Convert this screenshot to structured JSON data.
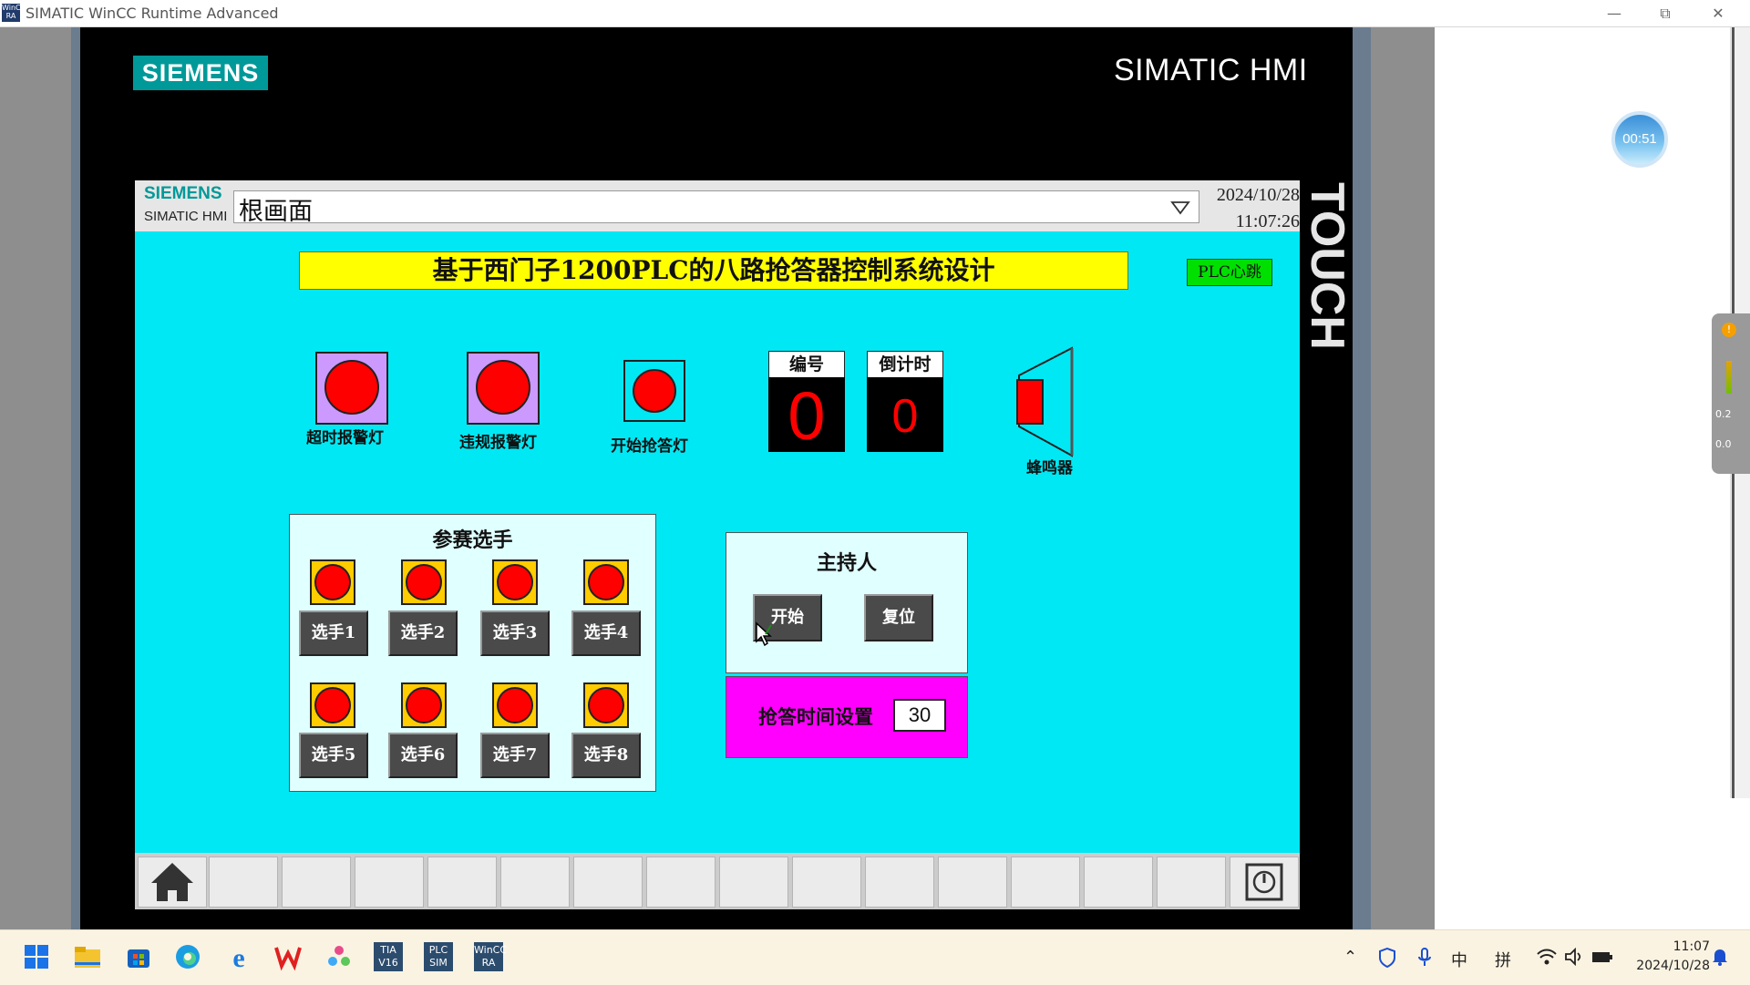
{
  "window": {
    "title": "SIMATIC WinCC Runtime Advanced",
    "app_icon": "WinCC RA",
    "controls": [
      "minimize-icon",
      "restore-icon",
      "close-icon"
    ]
  },
  "bezel": {
    "brand": "SIEMENS",
    "product": "SIMATIC HMI",
    "touch": "TOUCH"
  },
  "header": {
    "brand": "SIEMENS",
    "product": "SIMATIC HMI",
    "screen_name": "根画面",
    "date": "2024/10/28",
    "time": "11:07:26"
  },
  "main": {
    "title": "基于西门子1200PLC的八路抢答器控制系统设计",
    "heartbeat": "PLC心跳",
    "lamps": [
      {
        "label": "超时报警灯"
      },
      {
        "label": "违规报警灯"
      },
      {
        "label": "开始抢答灯"
      }
    ],
    "number_display": {
      "label": "编号",
      "value": "0"
    },
    "countdown_display": {
      "label": "倒计时",
      "value": "0"
    },
    "buzzer_label": "蜂鸣器",
    "players_panel": {
      "title": "参赛选手",
      "players": [
        "选手1",
        "选手2",
        "选手3",
        "选手4",
        "选手5",
        "选手6",
        "选手7",
        "选手8"
      ]
    },
    "host_panel": {
      "title": "主持人",
      "start_label": "开始",
      "reset_label": "复位"
    },
    "time_setting": {
      "label": "抢答时间设置",
      "value": "30"
    }
  },
  "side": {
    "timer": "00:51",
    "net_up": "0.2",
    "net_down": "0.0"
  },
  "taskbar": {
    "apps": [
      "windows-start-icon",
      "file-explorer-icon",
      "store-icon",
      "edge-icon",
      "ie-icon",
      "wps-icon",
      "network-app-icon",
      "TIA V16",
      "PLC SIM",
      "WinCC RA"
    ],
    "tray": {
      "input_mode": "中",
      "ime": "拼"
    },
    "clock_time": "11:07",
    "clock_date": "2024/10/28"
  },
  "colors": {
    "screen_bg": "#00e8f4",
    "title_bg": "#ffff00",
    "heartbeat_bg": "#00e000",
    "lamp_red": "#ff0000",
    "lamp_purple": "#cc99ff",
    "lamp_yellow": "#ffcc00",
    "time_panel_bg": "#ff00ff",
    "siemens_teal": "#009999"
  }
}
